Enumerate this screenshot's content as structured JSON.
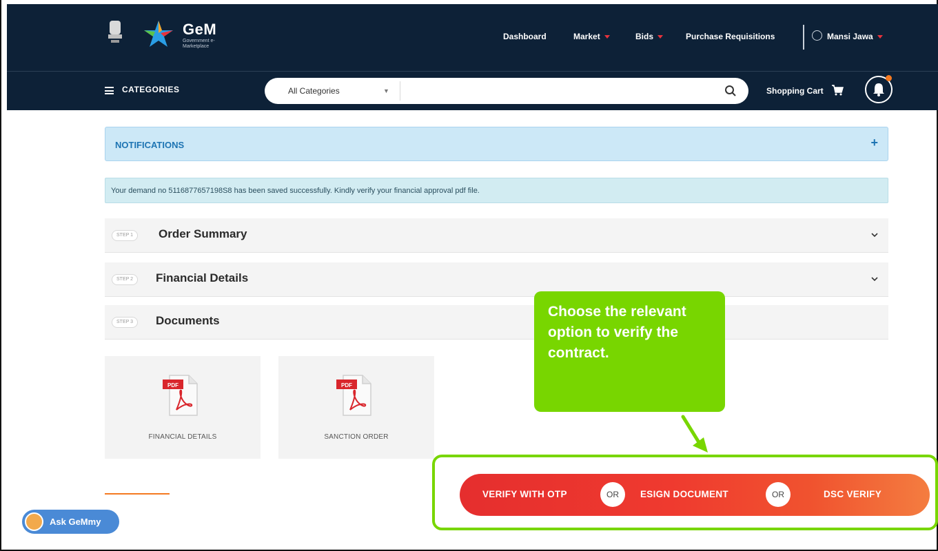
{
  "header": {
    "brand": "GeM",
    "brand_sub": "Government e-Marketplace",
    "nav": [
      {
        "label": "Dashboard",
        "has_caret": false
      },
      {
        "label": "Market",
        "has_caret": true
      },
      {
        "label": "Bids",
        "has_caret": true
      },
      {
        "label": "Purchase Requisitions",
        "has_caret": false
      }
    ],
    "user_name": "Mansi Jawa"
  },
  "toolbar": {
    "categories_label": "CATEGORIES",
    "search_category": "All Categories",
    "cart_label": "Shopping Cart"
  },
  "notifications": {
    "title": "NOTIFICATIONS",
    "expand_symbol": "+"
  },
  "alert": {
    "message": "Your demand no 5116877657198S8 has been saved successfully. Kindly verify your financial approval pdf file."
  },
  "steps": [
    {
      "badge": "STEP 1",
      "title": "Order Summary"
    },
    {
      "badge": "STEP 2",
      "title": "Financial Details"
    },
    {
      "badge": "STEP 3",
      "title": "Documents"
    }
  ],
  "documents": [
    {
      "label": "FINANCIAL DETAILS",
      "icon": "pdf-icon"
    },
    {
      "label": "SANCTION ORDER",
      "icon": "pdf-icon"
    }
  ],
  "tooltip": {
    "text": "Choose the relevant option to verify the contract."
  },
  "verify": {
    "otp_label": "VERIFY WITH OTP",
    "or_label": "OR",
    "esign_label": "ESIGN DOCUMENT",
    "dsc_label": "DSC VERIFY"
  },
  "assistant": {
    "label": "Ask GeMmy"
  },
  "colors": {
    "header_bg": "#0d2137",
    "accent_red": "#e8323c",
    "highlight_green": "#78d600",
    "notif_blue": "#1d74b3"
  }
}
